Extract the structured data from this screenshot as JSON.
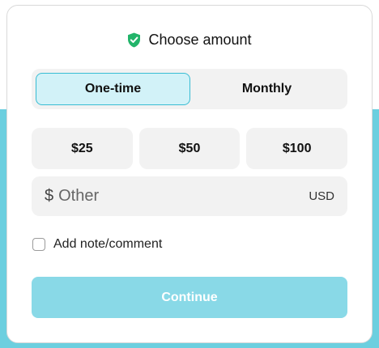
{
  "header": {
    "icon": "shield-check-icon",
    "title": "Choose amount"
  },
  "frequency": {
    "options": [
      "One-time",
      "Monthly"
    ],
    "selected": "One-time"
  },
  "amounts": [
    "$25",
    "$50",
    "$100"
  ],
  "other_amount": {
    "currency_symbol": "$",
    "placeholder": "Other",
    "value": "",
    "currency_code": "USD"
  },
  "note_checkbox": {
    "label": "Add note/comment",
    "checked": false
  },
  "continue_button": {
    "label": "Continue",
    "enabled": false
  },
  "colors": {
    "accent": "#38bcd3",
    "selected_bg": "#d2f2f8",
    "button_disabled_bg": "#89d9e7",
    "background_band": "#6ccfdf",
    "shield_green": "#22b46a"
  }
}
